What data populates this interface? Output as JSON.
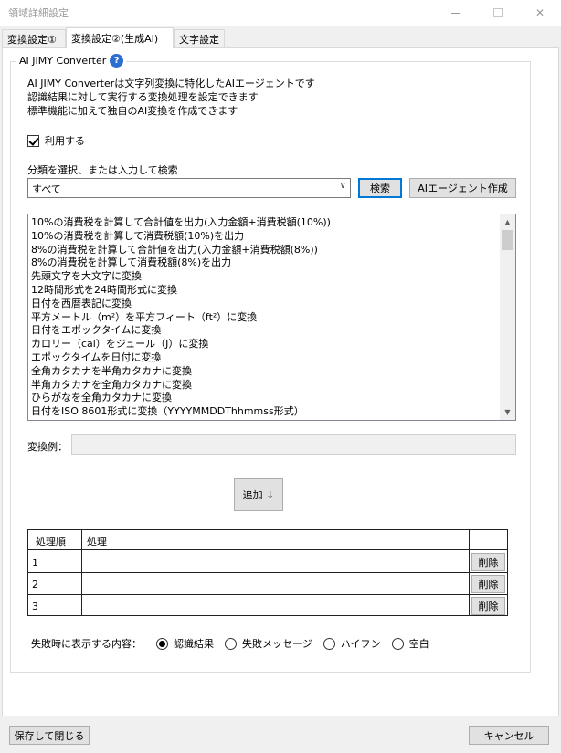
{
  "window": {
    "title": "領域詳細設定",
    "close_glyph": "✕"
  },
  "tabs": [
    {
      "label": "変換設定①"
    },
    {
      "label": "変換設定②(生成AI)"
    },
    {
      "label": "文字設定"
    }
  ],
  "group": {
    "title": "AI JIMY Converter",
    "help_glyph": "?",
    "description": [
      "AI JIMY Converterは文字列変換に特化したAIエージェントです",
      "認識結果に対して実行する変換処理を設定できます",
      "標準機能に加えて独自のAI変換を作成できます"
    ],
    "use_label": "利用する",
    "use_checked": true
  },
  "search": {
    "label": "分類を選択、または入力して検索",
    "selected": "すべて",
    "search_button": "検索",
    "agent_button": "AIエージェント作成"
  },
  "list_items": [
    "10%の消費税を計算して合計値を出力(入力金額+消費税額(10%))",
    "10%の消費税を計算して消費税額(10%)を出力",
    "8%の消費税を計算して合計値を出力(入力金額+消費税額(8%))",
    "8%の消費税を計算して消費税額(8%)を出力",
    "先頭文字を大文字に変換",
    "12時間形式を24時間形式に変換",
    "日付を西暦表記に変換",
    "平方メートル（m²）を平方フィート（ft²）に変換",
    "日付をエポックタイムに変換",
    "カロリー（cal）をジュール（J）に変換",
    "エポックタイムを日付に変換",
    "全角カタカナを半角カタカナに変換",
    "半角カタカナを全角カタカナに変換",
    "ひらがなを全角カタカナに変換",
    "日付をISO 8601形式に変換（YYYYMMDDThhmmss形式）"
  ],
  "example": {
    "label": "変換例：",
    "value": ""
  },
  "add_button": "追加 ↓",
  "process_table": {
    "headers": [
      "処理順",
      "処理"
    ],
    "rows": [
      {
        "order": "1",
        "process": "",
        "delete": "削除"
      },
      {
        "order": "2",
        "process": "",
        "delete": "削除"
      },
      {
        "order": "3",
        "process": "",
        "delete": "削除"
      }
    ]
  },
  "failure": {
    "label": "失敗時に表示する内容：",
    "options": [
      "認識結果",
      "失敗メッセージ",
      "ハイフン",
      "空白"
    ],
    "selected": "認識結果"
  },
  "footer": {
    "save_label": "保存して閉じる",
    "cancel_label": "キャンセル"
  }
}
